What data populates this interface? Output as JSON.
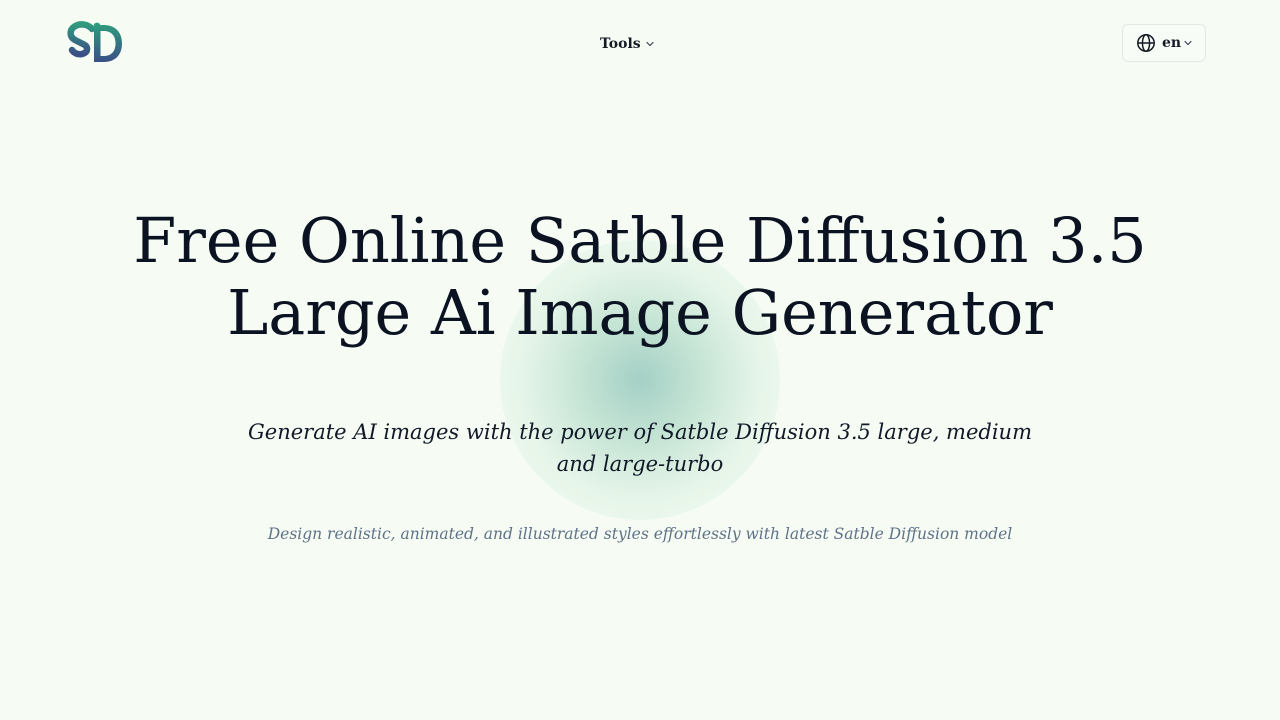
{
  "header": {
    "nav": {
      "tools_label": "Tools"
    },
    "language": {
      "current": "en"
    }
  },
  "hero": {
    "title": "Free Online Satble Diffusion 3.5 Large Ai Image Generator",
    "subtitle": "Generate AI images with the power of Satble Diffusion 3.5 large, medium and large-turbo",
    "description": "Design realistic, animated, and illustrated styles effortlessly with latest Satble Diffusion model"
  },
  "icons": {
    "logo": "sd-logo",
    "tools_chevron": "chevron-down-icon",
    "language": "globe-icon",
    "language_chevron": "chevron-down-icon"
  },
  "colors": {
    "background": "#f6fcf4",
    "title_text": "#0b1222",
    "description_text": "#5f7287",
    "logo_gradient_start": "#2f9a7e",
    "logo_gradient_end": "#3b4f86",
    "glow": "#a9d6c4"
  }
}
